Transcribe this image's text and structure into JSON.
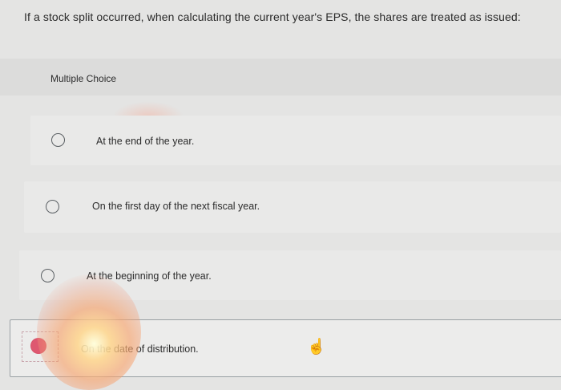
{
  "question": {
    "text": "If a stock split occurred, when calculating the current year's EPS, the shares are treated as issued:"
  },
  "multiple_choice": {
    "label": "Multiple Choice"
  },
  "options": [
    {
      "text": "At the end of the year.",
      "selected": false
    },
    {
      "text": "On the first day of the next fiscal year.",
      "selected": false
    },
    {
      "text": "At the beginning of the year.",
      "selected": false
    },
    {
      "text": "On the date of distribution.",
      "selected": true
    }
  ],
  "icons": {
    "radio": "radio-button-icon",
    "cursor": "hand-pointer-icon"
  },
  "colors": {
    "selected_radio": "#de5870",
    "background": "#e4e4e3"
  }
}
